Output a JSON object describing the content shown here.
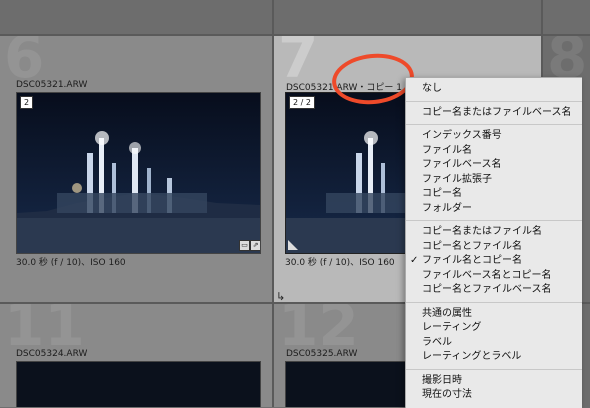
{
  "cells": [
    {
      "number": "6",
      "filename": "DSC05321.ARW",
      "badge": "2",
      "meta": "30.0 秒 (f / 10)、ISO 160"
    },
    {
      "number": "7",
      "filename": "DSC05321.ARW・コピー 1",
      "badge": "2 / 2",
      "meta": "30.0 秒 (f / 10)、ISO 160"
    },
    {
      "number": "8"
    },
    {
      "number": "11",
      "filename": "DSC05324.ARW"
    },
    {
      "number": "12",
      "filename": "DSC05325.ARW"
    }
  ],
  "menu": {
    "groups": [
      [
        {
          "label": "なし"
        }
      ],
      [
        {
          "label": "コピー名またはファイルベース名"
        }
      ],
      [
        {
          "label": "インデックス番号"
        },
        {
          "label": "ファイル名"
        },
        {
          "label": "ファイルベース名"
        },
        {
          "label": "ファイル拡張子"
        },
        {
          "label": "コピー名"
        },
        {
          "label": "フォルダー"
        }
      ],
      [
        {
          "label": "コピー名またはファイル名"
        },
        {
          "label": "コピー名とファイル名"
        },
        {
          "label": "ファイル名とコピー名",
          "checked": true
        },
        {
          "label": "ファイルベース名とコピー名"
        },
        {
          "label": "コピー名とファイルベース名"
        }
      ],
      [
        {
          "label": "共通の属性"
        },
        {
          "label": "レーティング"
        },
        {
          "label": "ラベル"
        },
        {
          "label": "レーティングとラベル"
        }
      ],
      [
        {
          "label": "撮影日時"
        },
        {
          "label": "現在の寸法"
        }
      ]
    ]
  },
  "icons": {
    "check": "checkmark-icon",
    "rotate": "rotate-arrow-icon"
  },
  "colors": {
    "annotation": "#ee4a2a",
    "selected_cell": "#b9b9b9"
  }
}
